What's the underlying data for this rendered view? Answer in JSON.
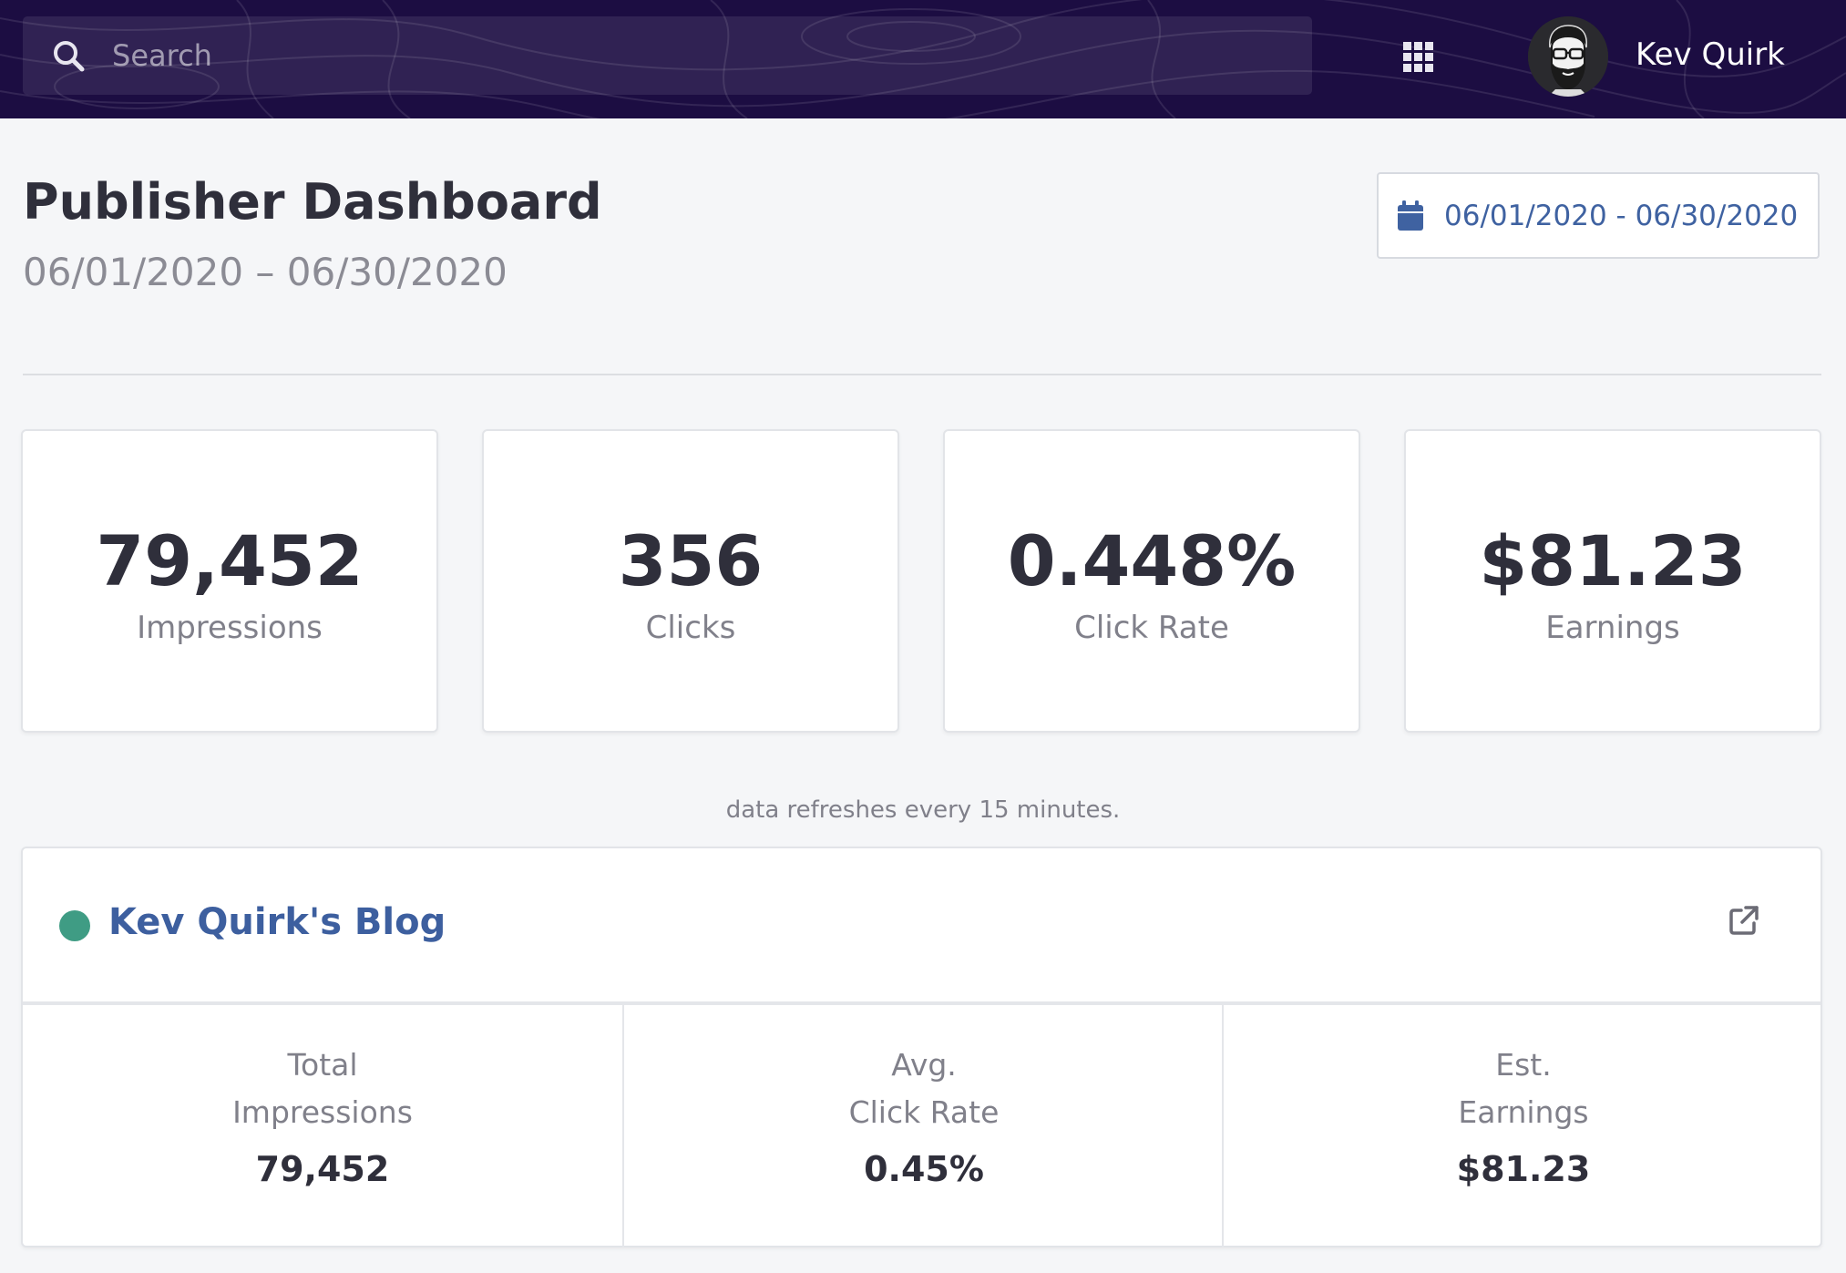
{
  "colors": {
    "topbar_bg": "#1c0d42",
    "page_bg": "#f5f6f8",
    "accent_blue": "#3d5f9f",
    "status_green": "#3f9c84"
  },
  "topbar": {
    "search": {
      "placeholder": "Search",
      "value": "",
      "icon": "search-icon"
    },
    "apps_icon": "grid-icon",
    "user": {
      "name": "Kev Quirk",
      "avatar_icon": "bearded-glasses-avatar"
    }
  },
  "header": {
    "title": "Publisher Dashboard",
    "subtitle": "06/01/2020 – 06/30/2020",
    "date_range_button": {
      "icon": "calendar-icon",
      "label": "06/01/2020 - 06/30/2020"
    }
  },
  "stats": [
    {
      "value": "79,452",
      "label": "Impressions"
    },
    {
      "value": "356",
      "label": "Clicks"
    },
    {
      "value": "0.448%",
      "label": "Click Rate"
    },
    {
      "value": "$81.23",
      "label": "Earnings"
    }
  ],
  "refresh_note": "data refreshes every 15 minutes.",
  "site": {
    "name": "Kev Quirk's Blog",
    "status": "active",
    "external_link_icon": "external-link-icon",
    "stats": [
      {
        "label_line1": "Total",
        "label_line2": "Impressions",
        "value": "79,452"
      },
      {
        "label_line1": "Avg.",
        "label_line2": "Click Rate",
        "value": "0.45%"
      },
      {
        "label_line1": "Est.",
        "label_line2": "Earnings",
        "value": "$81.23"
      }
    ]
  }
}
